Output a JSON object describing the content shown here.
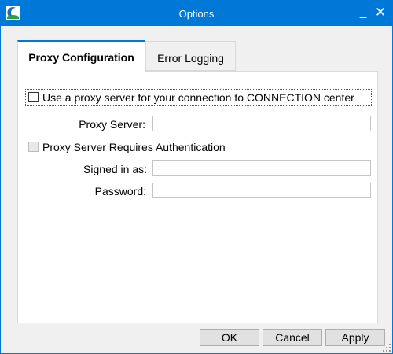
{
  "window": {
    "title": "Options",
    "minimize_glyph": "_",
    "close_glyph": "✕",
    "icon": "app-logo-icon",
    "accent_color": "#0078d7"
  },
  "tabs": [
    {
      "label": "Proxy Configuration",
      "active": true
    },
    {
      "label": "Error Logging",
      "active": false
    }
  ],
  "proxy": {
    "use_proxy_label": "Use a proxy server for your connection to CONNECTION center",
    "use_proxy_checked": false,
    "proxy_server_label": "Proxy Server:",
    "proxy_server_value": "",
    "auth_label": "Proxy Server Requires Authentication",
    "auth_checked": false,
    "auth_enabled": false,
    "signed_in_label": "Signed in as:",
    "signed_in_value": "",
    "password_label": "Password:",
    "password_value": ""
  },
  "buttons": {
    "ok": "OK",
    "cancel": "Cancel",
    "apply": "Apply"
  }
}
